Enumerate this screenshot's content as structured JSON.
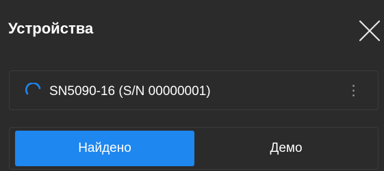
{
  "header": {
    "title": "Устройства",
    "close_icon": "close-icon"
  },
  "device": {
    "status_icon": "loading-spinner-icon",
    "label": "SN5090-16 (S/N 00000001)",
    "menu_icon": "vertical-dots-icon"
  },
  "tabs": {
    "found": "Найдено",
    "demo": "Демо",
    "selected": "found"
  },
  "colors": {
    "background": "#2b2b2b",
    "accent": "#1e87f0",
    "border": "#3c3c3c",
    "text": "#ffffff"
  }
}
